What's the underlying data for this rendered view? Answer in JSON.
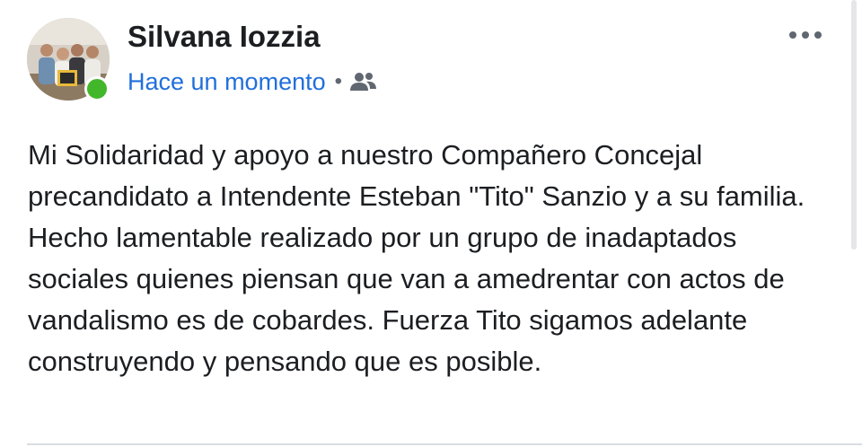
{
  "post": {
    "author_name": "Silvana Iozzia",
    "timestamp": "Hace un momento",
    "separator": "•",
    "audience_icon": "friends-icon",
    "more_icon": "more-options-icon",
    "body_text": "Mi Solidaridad y apoyo a nuestro Compañero Concejal precandidato a Intendente Esteban \"Tito\" Sanzio y a su familia. Hecho lamentable realizado por un grupo de inadaptados sociales quienes piensan que van a amedrentar con actos de vandalismo es de cobardes. Fuerza Tito sigamos adelante construyendo y pensando que es posible.",
    "online": true
  },
  "colors": {
    "name": "#1c1e21",
    "timestamp_link": "#216fdb",
    "online_indicator": "#42b72a",
    "icon_gray": "#606770"
  }
}
